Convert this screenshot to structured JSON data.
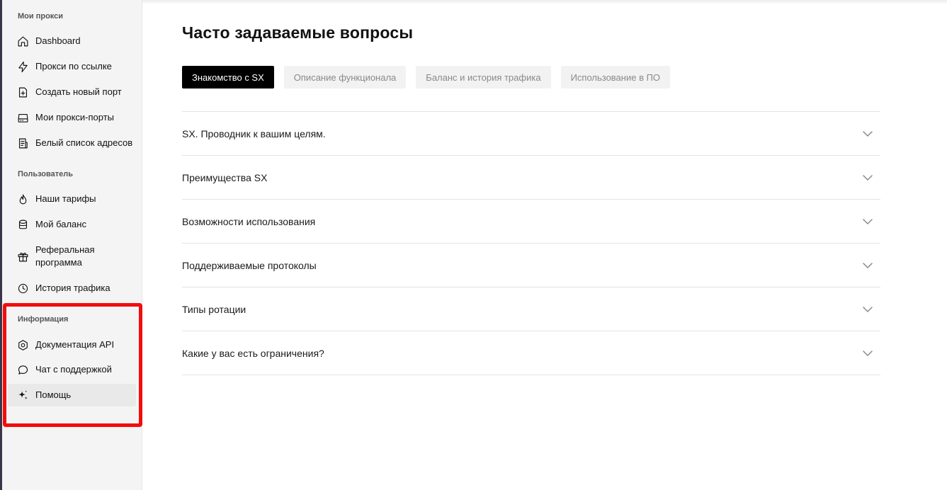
{
  "sidebar": {
    "sections": [
      {
        "title": "Мои прокси",
        "items": [
          {
            "label": "Dashboard",
            "icon": "home-icon"
          },
          {
            "label": "Прокси по ссылке",
            "icon": "lightning-icon"
          },
          {
            "label": "Создать новый порт",
            "icon": "add-file-icon"
          },
          {
            "label": "Мои прокси-порты",
            "icon": "server-icon"
          },
          {
            "label": "Белый список адресов",
            "icon": "list-icon"
          }
        ]
      },
      {
        "title": "Пользователь",
        "items": [
          {
            "label": "Наши тарифы",
            "icon": "fire-icon"
          },
          {
            "label": "Мой баланс",
            "icon": "database-icon"
          },
          {
            "label": "Реферальная программа",
            "icon": "gift-icon"
          },
          {
            "label": "История трафика",
            "icon": "clock-icon"
          }
        ]
      },
      {
        "title": "Информация",
        "items": [
          {
            "label": "Документация API",
            "icon": "gear-icon"
          },
          {
            "label": "Чат с поддержкой",
            "icon": "chat-icon"
          },
          {
            "label": "Помощь",
            "icon": "sparkle-icon",
            "active": true
          }
        ]
      }
    ]
  },
  "annotation": {
    "color": "#f20d0d"
  },
  "main": {
    "title": "Часто задаваемые вопросы",
    "tabs": [
      {
        "label": "Знакомство с SX",
        "active": true
      },
      {
        "label": "Описание функционала"
      },
      {
        "label": "Баланс и история трафика"
      },
      {
        "label": "Использование в ПО"
      }
    ],
    "faq": [
      {
        "question": "SX. Проводник к вашим целям."
      },
      {
        "question": "Преимущества SX"
      },
      {
        "question": "Возможности использования"
      },
      {
        "question": "Поддерживаемые протоколы"
      },
      {
        "question": "Типы ротации"
      },
      {
        "question": "Какие у вас есть ограничения?"
      }
    ]
  }
}
